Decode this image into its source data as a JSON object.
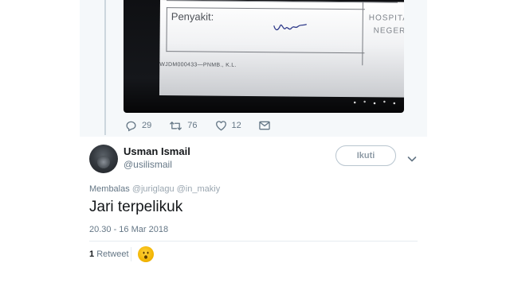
{
  "image_card": {
    "form_label": "Penyakit:",
    "form_code": "WJDM000433—PNMB., K.L.",
    "side_text_1": "HOSPITA",
    "side_text_2": "NEGER"
  },
  "actions": {
    "replies": "29",
    "retweets": "76",
    "likes": "12"
  },
  "reply": {
    "display_name": "Usman Ismail",
    "handle": "@usilismail",
    "follow_label": "Ikuti",
    "replying_label": "Membalas",
    "replying_mentions": "@juriglagu @in_makiy",
    "text": "Jari terpelikuk",
    "timestamp": "20.30 - 16 Mar 2018",
    "retweet_count": "1",
    "retweet_label": "Retweet"
  },
  "colors": {
    "secondary_text": "#657786",
    "thread_background": "#f5f8fa",
    "divider": "#e6ecf0"
  },
  "icons": [
    "reply-icon",
    "retweet-icon",
    "like-icon",
    "message-icon",
    "chevron-down-icon"
  ]
}
